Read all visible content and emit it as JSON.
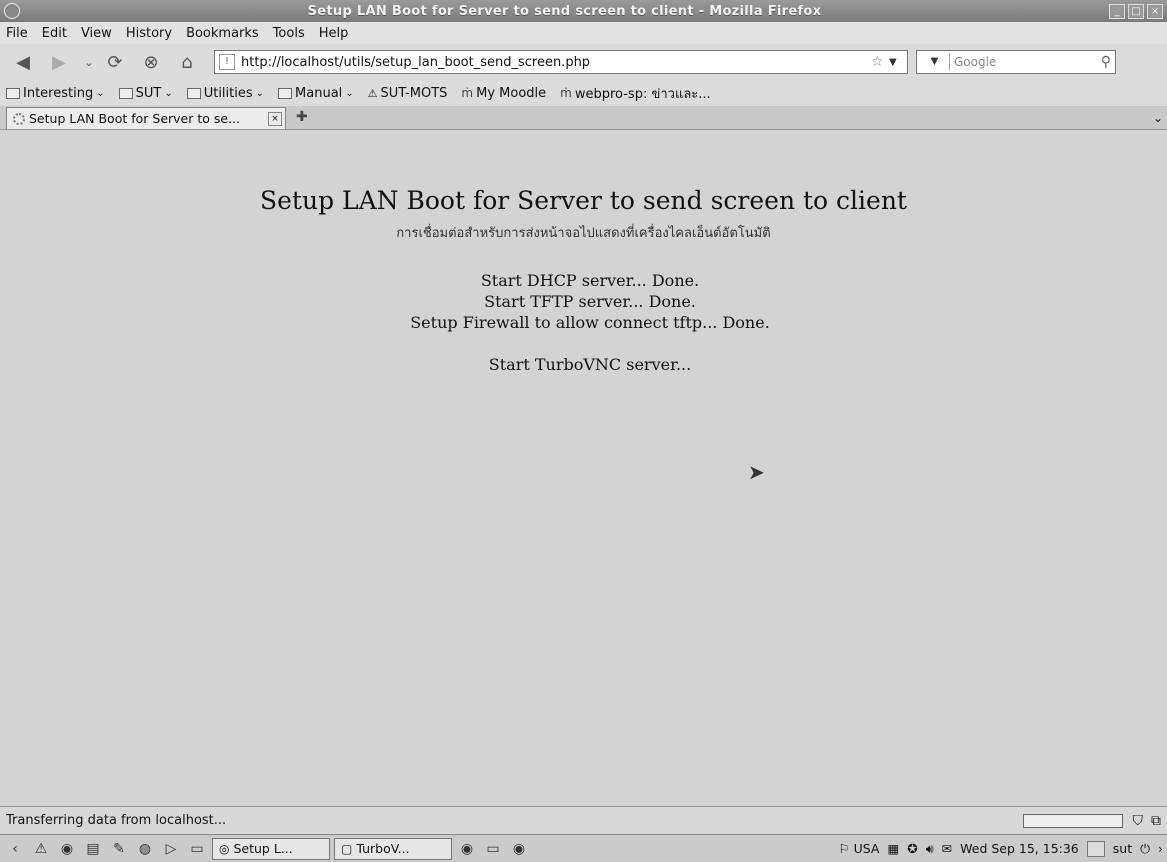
{
  "window": {
    "title": "Setup LAN Boot for Server to send screen to client - Mozilla Firefox",
    "buttons": [
      "_",
      "□",
      "×"
    ]
  },
  "menu": {
    "items": [
      "File",
      "Edit",
      "View",
      "History",
      "Bookmarks",
      "Tools",
      "Help"
    ]
  },
  "nav": {
    "url": "http://localhost/utils/setup_lan_boot_send_screen.php",
    "search_placeholder": "Google"
  },
  "bookmarks": {
    "items": [
      {
        "label": "Interesting",
        "type": "folder"
      },
      {
        "label": "SUT",
        "type": "folder"
      },
      {
        "label": "Utilities",
        "type": "folder"
      },
      {
        "label": "Manual",
        "type": "folder"
      },
      {
        "label": "SUT-MOTS",
        "type": "link"
      },
      {
        "label": "My Moodle",
        "type": "link"
      },
      {
        "label": "webpro-sp: ข่าวและ...",
        "type": "link"
      }
    ]
  },
  "tabs": [
    {
      "label": "Setup LAN Boot for Server to se..."
    }
  ],
  "page": {
    "heading": "Setup LAN Boot for Server to send screen to client",
    "subheading": "การเชื่อมต่อสำหรับการส่งหน้าจอไปแสดงที่เครื่องไคลเอ็นต์อัตโนมัติ",
    "lines": [
      "Start DHCP server... Done.",
      "Start TFTP server... Done.",
      "Setup Firewall to allow connect tftp... Done.",
      "Start TurboVNC server..."
    ]
  },
  "status": {
    "text": "Transferring data from localhost..."
  },
  "taskbar": {
    "windows": [
      "Setup L...",
      "TurboV..."
    ],
    "keyboard": "USA",
    "clock": "Wed Sep 15, 15:36",
    "user": "sut"
  }
}
